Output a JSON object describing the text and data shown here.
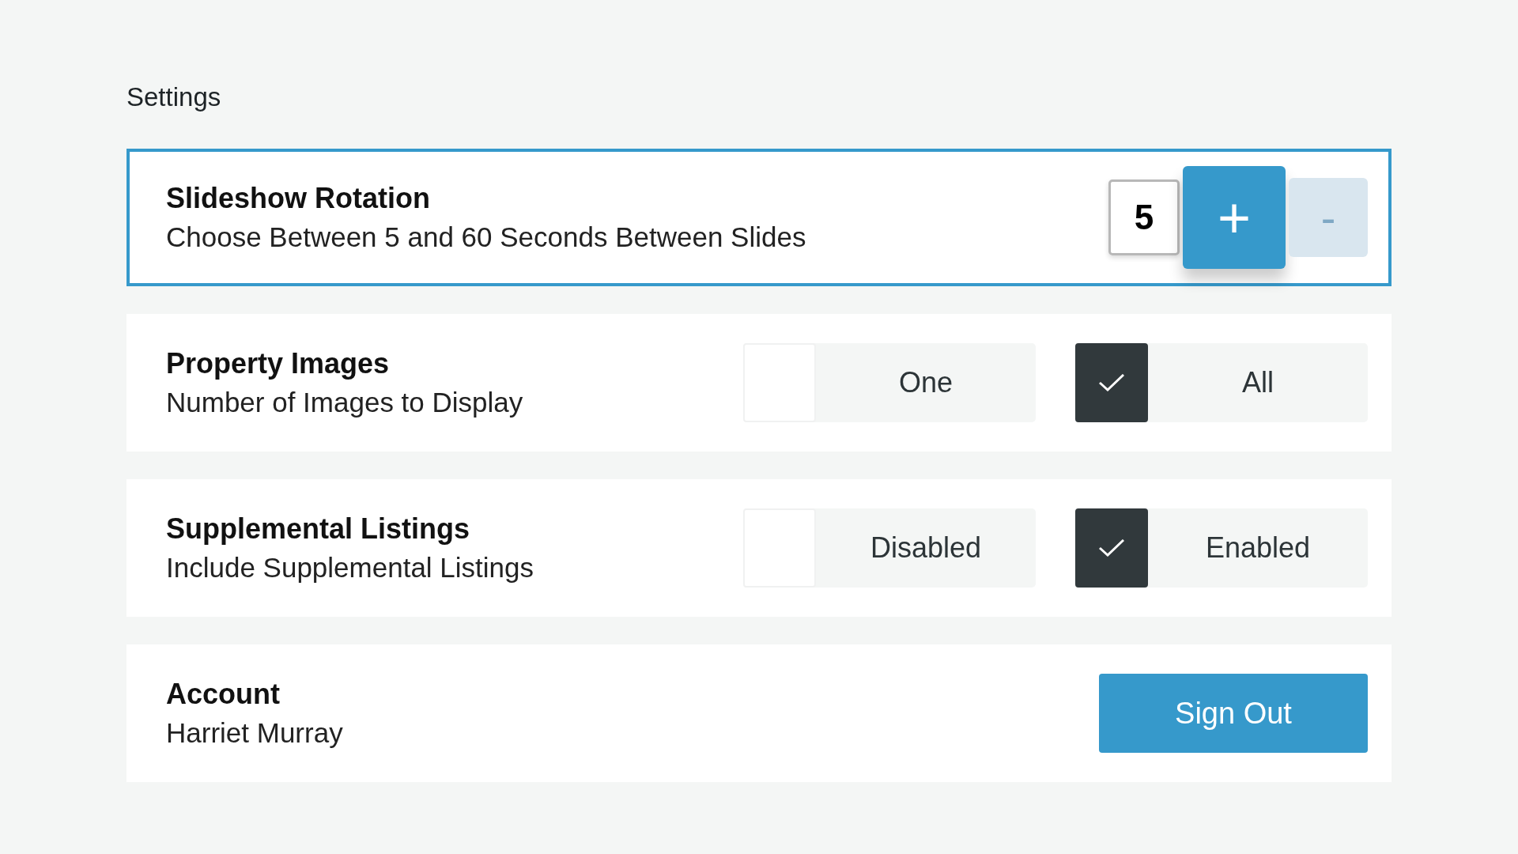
{
  "heading": "Settings",
  "sections": [
    {
      "kind": "stepper",
      "focused": true,
      "title": "Slideshow Rotation",
      "subtitle": "Choose Between 5 and 60 Seconds Between Slides",
      "value": "5",
      "increment": {
        "label": "+",
        "disabled": false
      },
      "decrement": {
        "label": "-",
        "disabled": true
      }
    },
    {
      "kind": "choice",
      "focused": false,
      "title": "Property Images",
      "subtitle": "Number of Images to Display",
      "options": [
        {
          "label": "One",
          "selected": false
        },
        {
          "label": "All",
          "selected": true
        }
      ]
    },
    {
      "kind": "choice",
      "focused": false,
      "title": "Supplemental Listings",
      "subtitle": "Include Supplemental Listings",
      "options": [
        {
          "label": "Disabled",
          "selected": false
        },
        {
          "label": "Enabled",
          "selected": true
        }
      ]
    },
    {
      "kind": "button",
      "focused": false,
      "title": "Account",
      "subtitle": "Harriet Murray",
      "button": "Sign Out"
    }
  ]
}
